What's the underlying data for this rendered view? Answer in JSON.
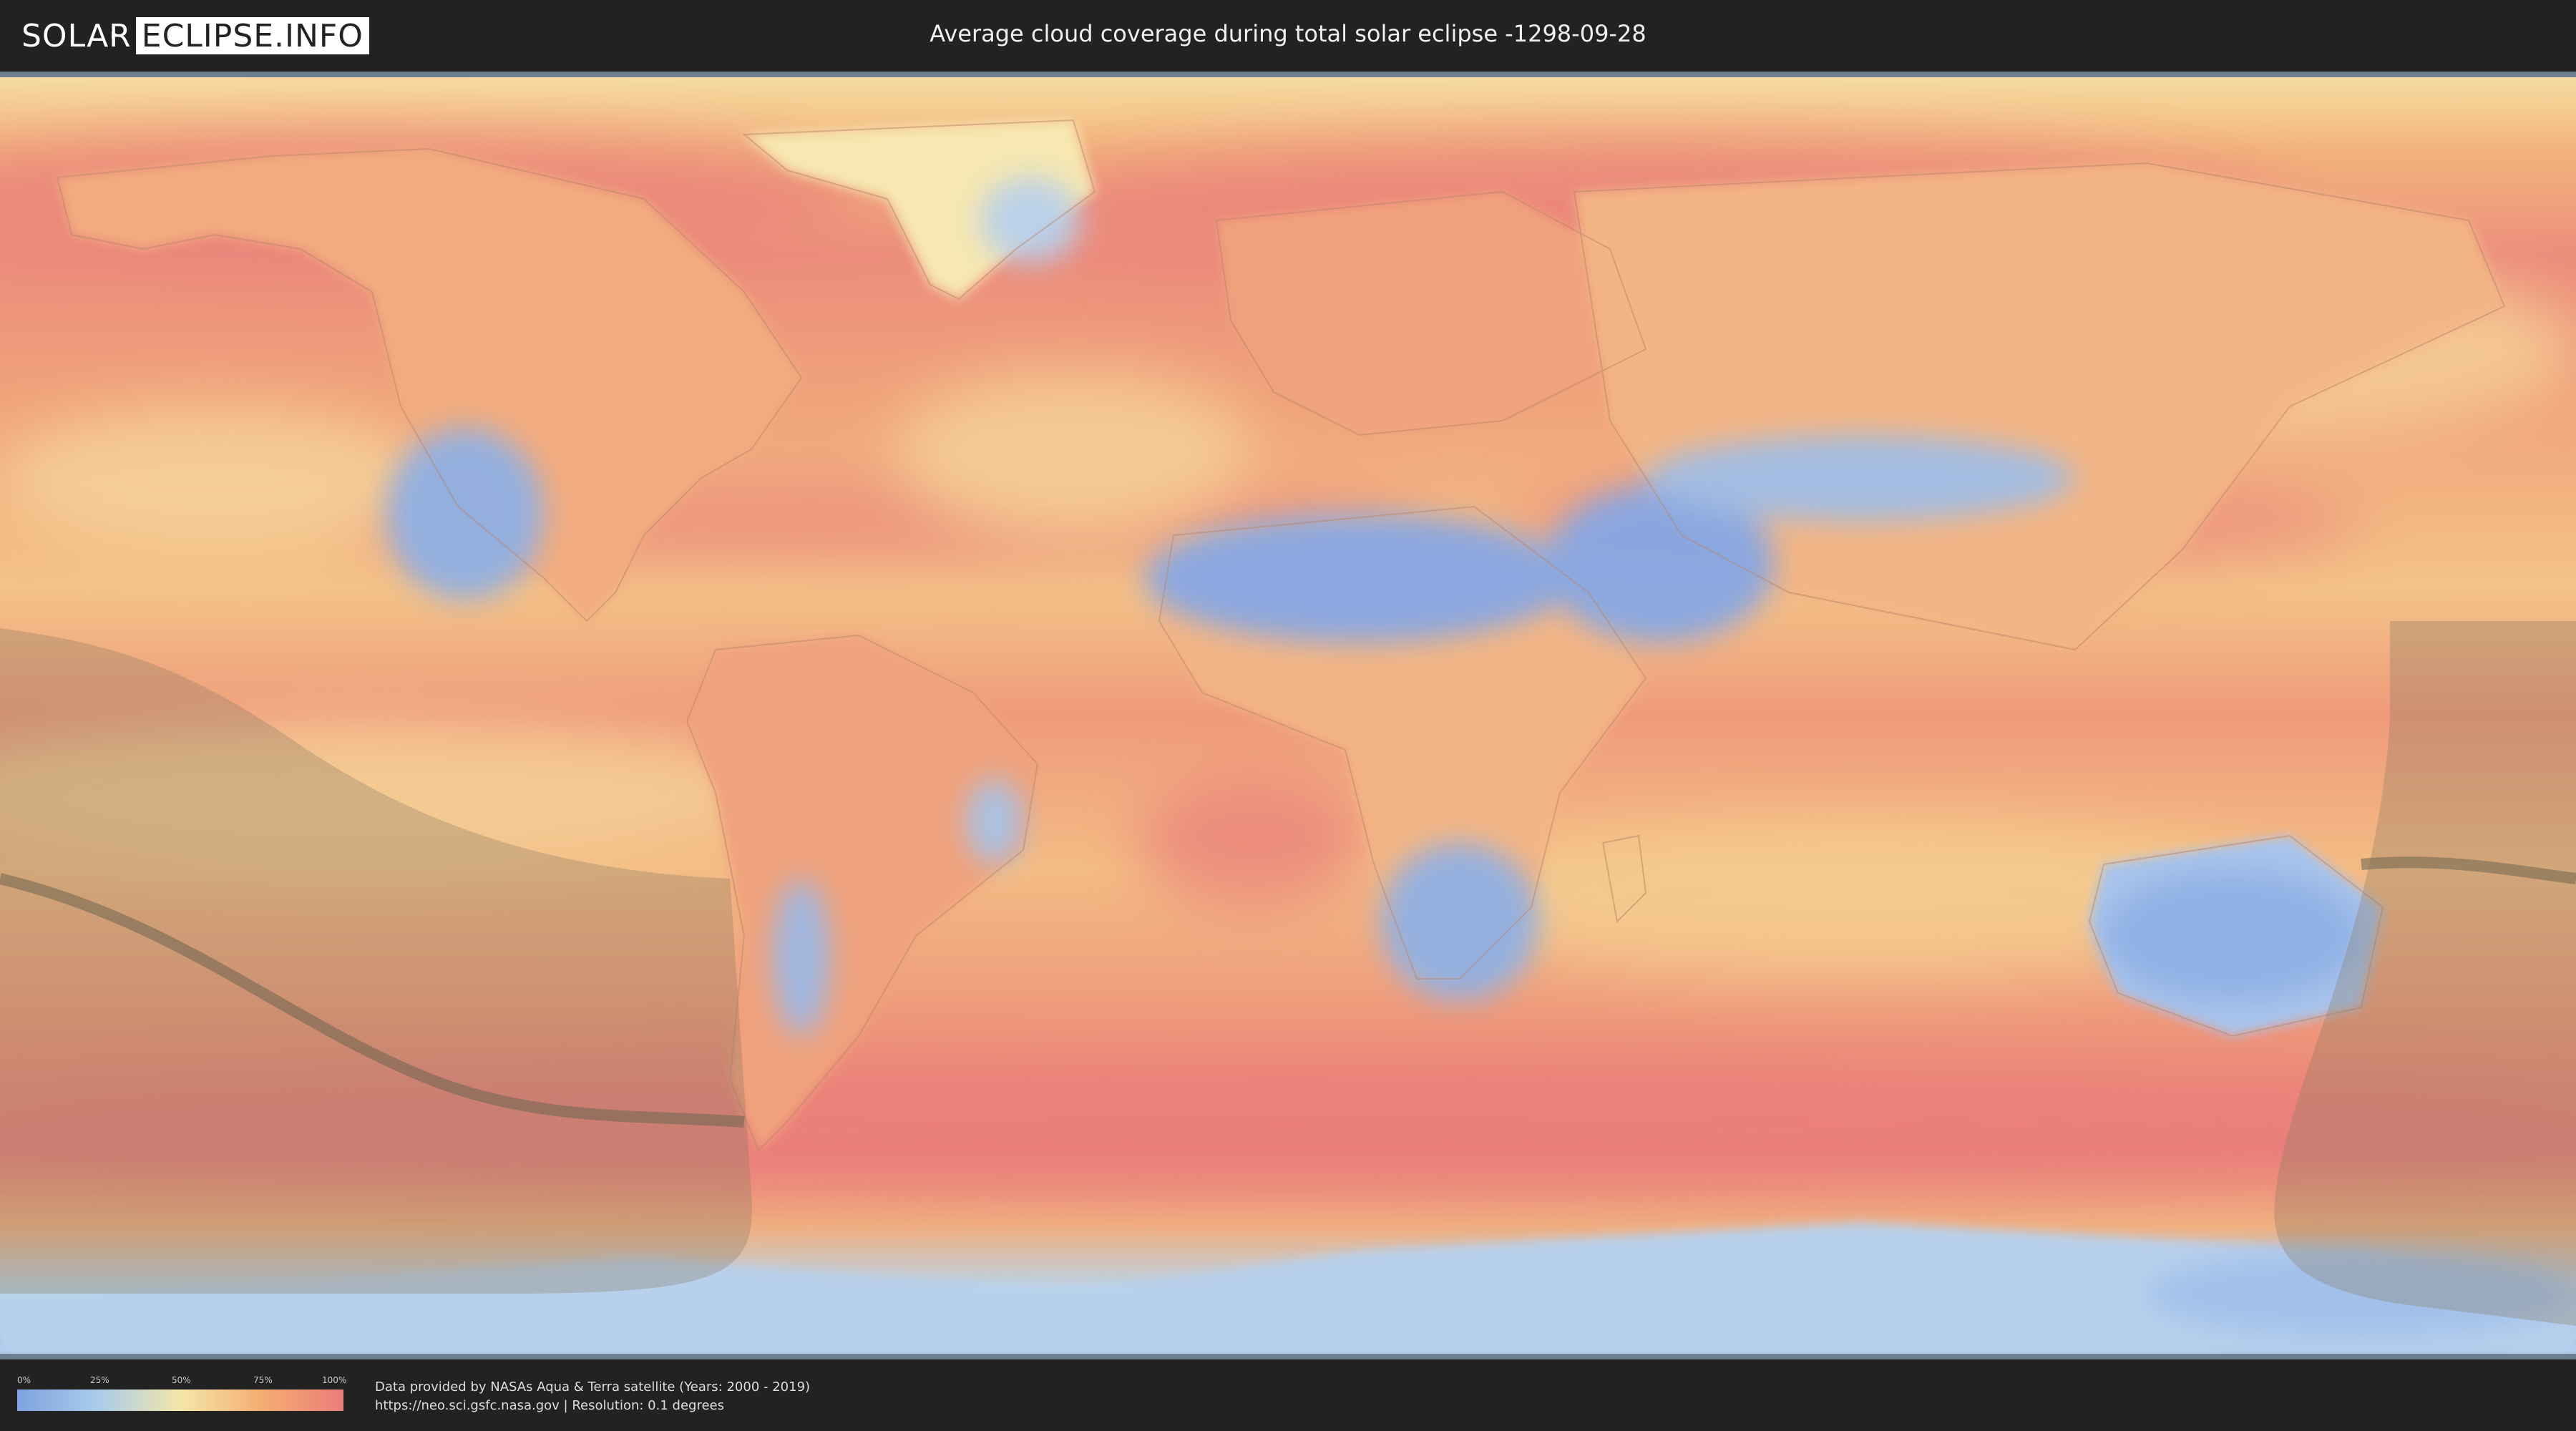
{
  "header": {
    "logo_left": "SOLAR",
    "logo_right": "ECLIPSE.INFO",
    "title": "Average cloud coverage during total solar eclipse -1298-09-28"
  },
  "legend": {
    "ticks": [
      "0%",
      "25%",
      "50%",
      "75%",
      "100%"
    ],
    "colors": [
      "#7fa3e0",
      "#a9ccea",
      "#f4e6a8",
      "#f4ad72",
      "#ec7c7a"
    ]
  },
  "footer": {
    "line1": "Data provided by NASAs Aqua & Terra satellite (Years: 2000 - 2019)",
    "line2": "https://neo.sci.gsfc.nasa.gov | Resolution: 0.1 degrees"
  },
  "map": {
    "ocean_color": "#f1a57a",
    "high_cloud_color": "#ea7f7c",
    "clear_color": "#8fb0e4",
    "eclipse_band_color": "#8a7a60"
  }
}
